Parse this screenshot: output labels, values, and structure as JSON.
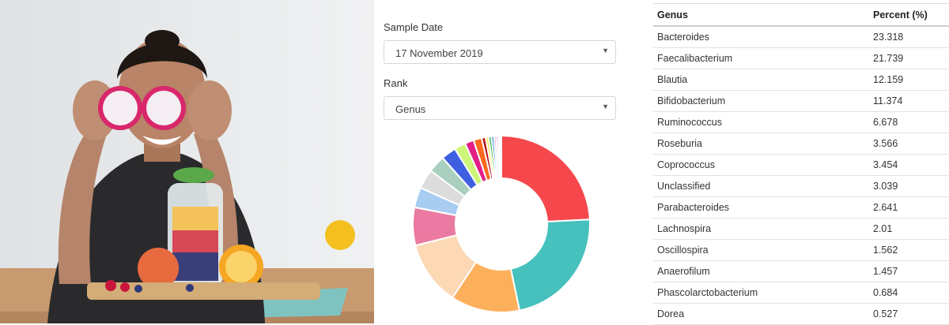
{
  "filters": {
    "sample_date_label": "Sample Date",
    "sample_date_value": "17 November 2019",
    "rank_label": "Rank",
    "rank_value": "Genus"
  },
  "table": {
    "headers": [
      "Genus",
      "Percent (%)"
    ],
    "rows": [
      [
        "Bacteroides",
        "23.318"
      ],
      [
        "Faecalibacterium",
        "21.739"
      ],
      [
        "Blautia",
        "12.159"
      ],
      [
        "Bifidobacterium",
        "11.374"
      ],
      [
        "Ruminococcus",
        "6.678"
      ],
      [
        "Roseburia",
        "3.566"
      ],
      [
        "Coprococcus",
        "3.454"
      ],
      [
        "Unclassified",
        "3.039"
      ],
      [
        "Parabacteroides",
        "2.641"
      ],
      [
        "Lachnospira",
        "2.01"
      ],
      [
        "Oscillospira",
        "1.562"
      ],
      [
        "Anaerofilum",
        "1.457"
      ],
      [
        "Phascolarctobacterium",
        "0.684"
      ],
      [
        "Dorea",
        "0.527"
      ]
    ]
  },
  "chart_data": {
    "type": "pie",
    "values": [
      23.318,
      21.739,
      12.159,
      11.374,
      6.678,
      3.566,
      3.454,
      3.039,
      2.641,
      2.01,
      1.562,
      1.457,
      0.684,
      0.527,
      0.5,
      0.45,
      0.4,
      0.35,
      0.3,
      0.25
    ],
    "colors": [
      "#f5474c",
      "#46c1bd",
      "#fdb05c",
      "#fdd8b5",
      "#ea7aa1",
      "#a9cdf1",
      "#dcdcdc",
      "#aacfbf",
      "#3e5fe0",
      "#cdf57a",
      "#e11f86",
      "#ff6a1f",
      "#b90f1a",
      "#f9e94e",
      "#3fb44a",
      "#1f8bd8",
      "#f4a3c0",
      "#8d5bd1",
      "#5fcfd6",
      "#b0b0b0"
    ]
  }
}
